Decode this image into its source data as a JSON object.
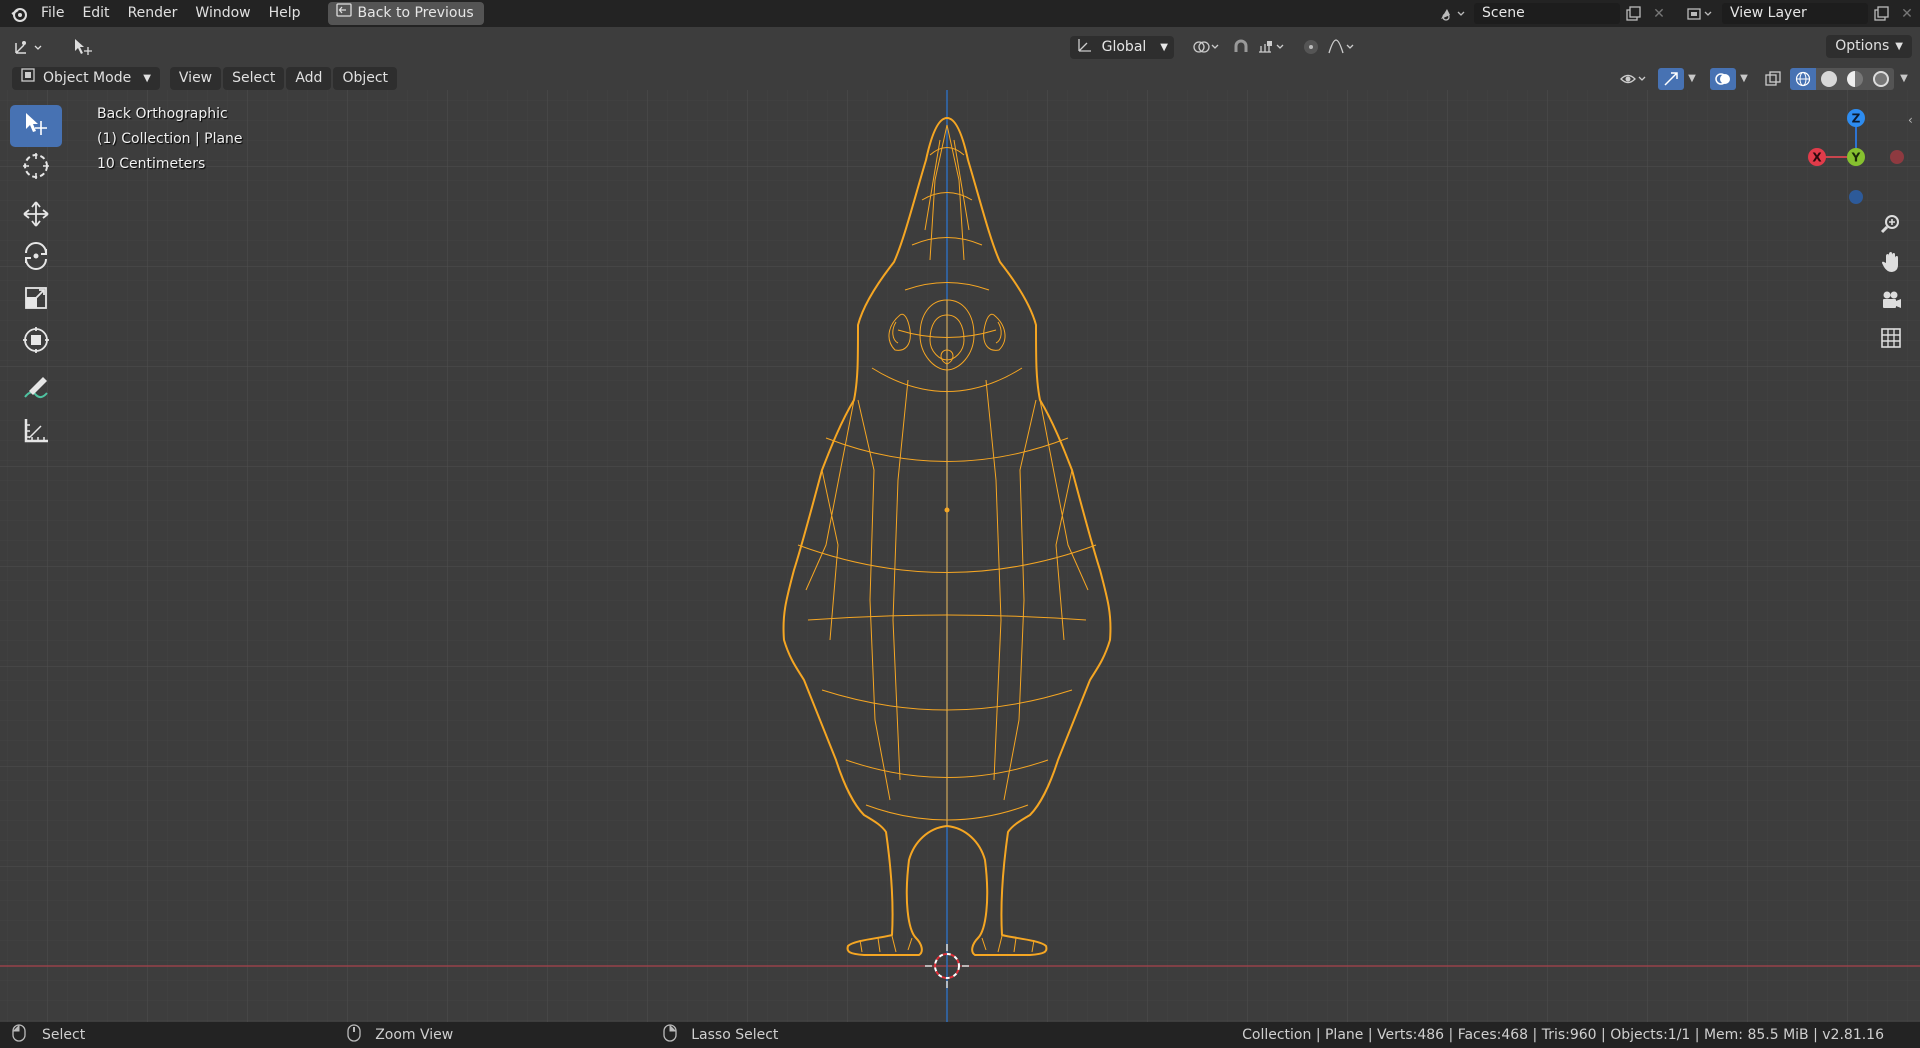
{
  "menu": {
    "file": "File",
    "edit": "Edit",
    "render": "Render",
    "window": "Window",
    "help": "Help",
    "back_to_previous": "Back to Previous"
  },
  "scene": {
    "name": "Scene",
    "view_layer": "View Layer"
  },
  "tool_header": {
    "transform_orientation": "Global",
    "options": "Options"
  },
  "view_header": {
    "mode": "Object Mode",
    "view": "View",
    "select": "Select",
    "add": "Add",
    "object": "Object"
  },
  "viewport": {
    "view_name": "Back Orthographic",
    "collection_info": "(1) Collection | Plane",
    "grid_scale": "10 Centimeters"
  },
  "gizmo": {
    "z": "Z",
    "x": "X",
    "y": "Y"
  },
  "toolbar_tools": [
    "select-box",
    "cursor",
    "move",
    "rotate",
    "scale",
    "transform",
    "annotate",
    "measure"
  ],
  "statusbar": {
    "select": "Select",
    "zoom_view": "Zoom View",
    "lasso_select": "Lasso Select",
    "stats": "Collection | Plane | Verts:486 | Faces:468 | Tris:960 | Objects:1/1 | Mem: 85.5 MiB | v2.81.16"
  },
  "colors": {
    "background": "#3d3d3d",
    "grid_major": "#4a4a4a",
    "selection_orange": "#f5a623",
    "x_axis": "#c8454d",
    "z_axis": "#2d73d1",
    "y_axis": "#86c12f",
    "active_tool": "#4772b3"
  }
}
